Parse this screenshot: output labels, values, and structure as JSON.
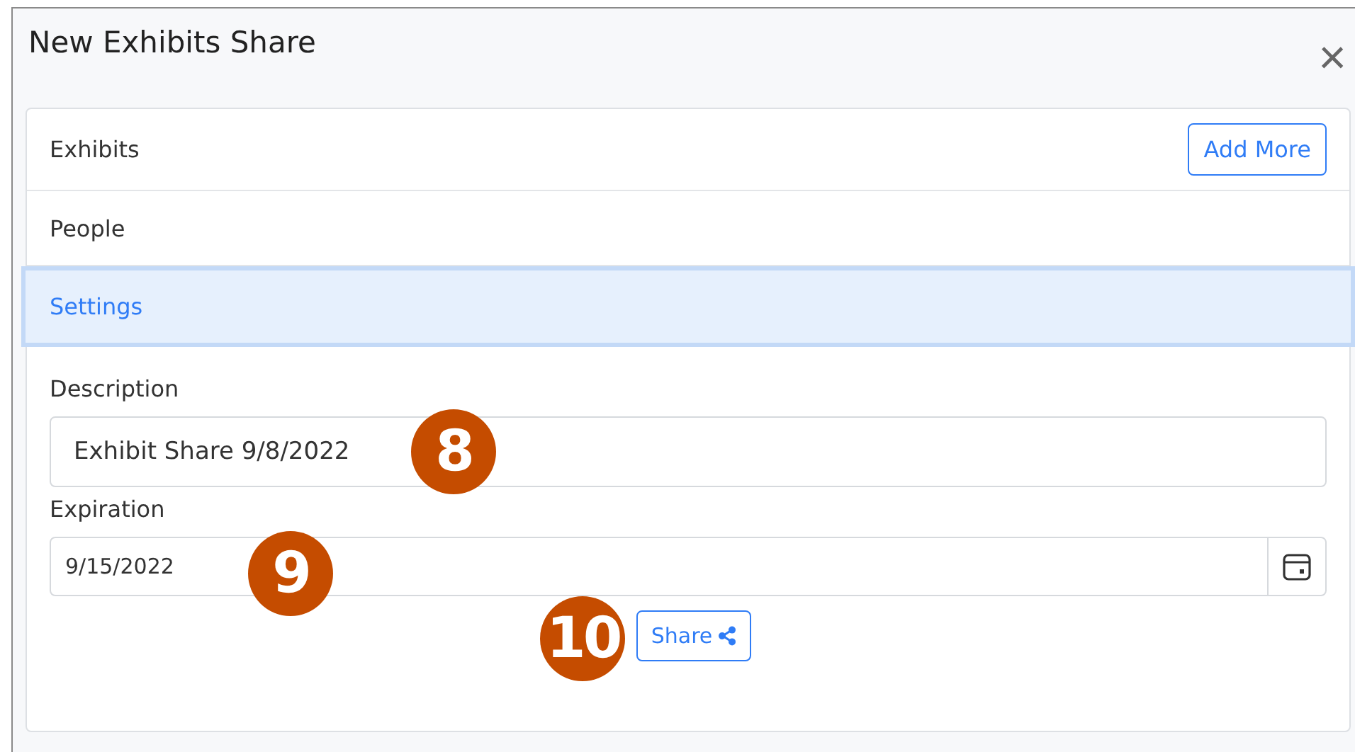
{
  "dialog": {
    "title": "New Exhibits Share",
    "close": "×"
  },
  "sections": [
    {
      "label": "Exhibits",
      "selected": false,
      "action": "Add More"
    },
    {
      "label": "People",
      "selected": false
    },
    {
      "label": "Settings",
      "selected": true
    }
  ],
  "fields": [
    {
      "kind": "text",
      "label": "Description",
      "value": "Exhibit Share 9/8/2022",
      "callout": "8"
    },
    {
      "kind": "date",
      "label": "Expiration",
      "value": "9/15/2022",
      "callout": "9"
    }
  ],
  "share_button": {
    "label": "Share",
    "callout": "10"
  }
}
